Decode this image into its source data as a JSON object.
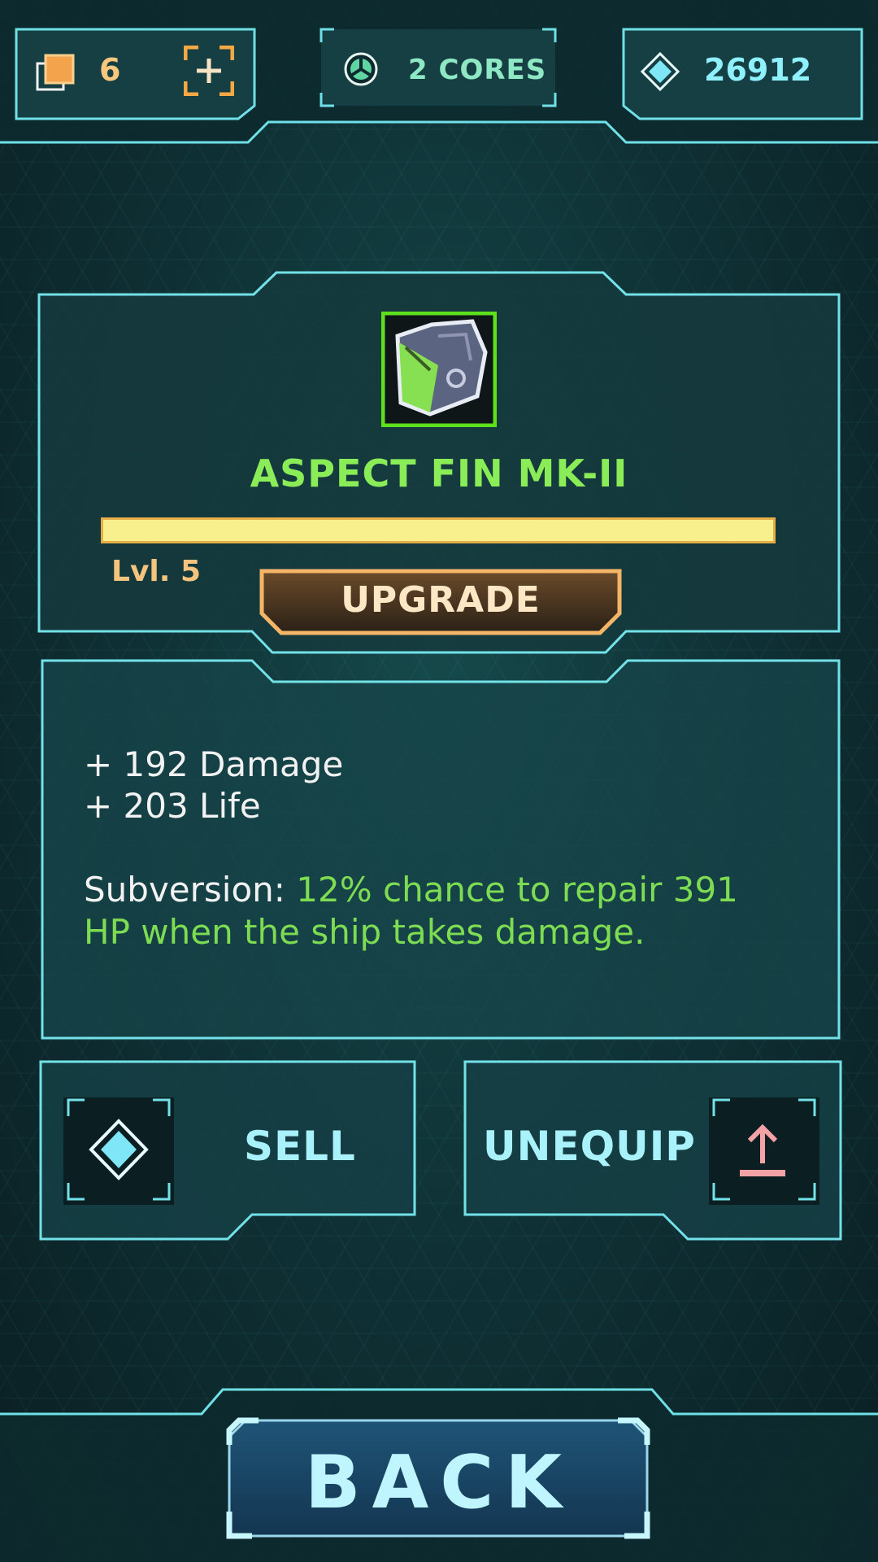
{
  "header": {
    "resource_count": "6",
    "cores_label": "2 CORES",
    "gem_count": "26912"
  },
  "item": {
    "name": "ASPECT FIN MK-II",
    "level_label": "Lvl. 5",
    "progress_fraction": 1.0,
    "upgrade_label": "UPGRADE"
  },
  "stats": {
    "damage": "+ 192 Damage",
    "life": "+ 203 Life",
    "ability_name": "Subversion:",
    "ability_text_line1": "12% chance to repair 391",
    "ability_text_line2": "HP when the ship takes damage."
  },
  "actions": {
    "sell_label": "SELL",
    "unequip_label": "UNEQUIP",
    "back_label": "BACK"
  },
  "icons": {
    "resource": "stacked-cards-icon",
    "add": "add-bracket-icon",
    "cores": "core-icon",
    "gem": "diamond-icon",
    "unequip": "upload-arrow-icon"
  },
  "colors": {
    "accent_cyan": "#8ff0ff",
    "item_green": "#8aed57",
    "gold": "#f4c47f",
    "unequip_pink": "#f3a2a6"
  }
}
